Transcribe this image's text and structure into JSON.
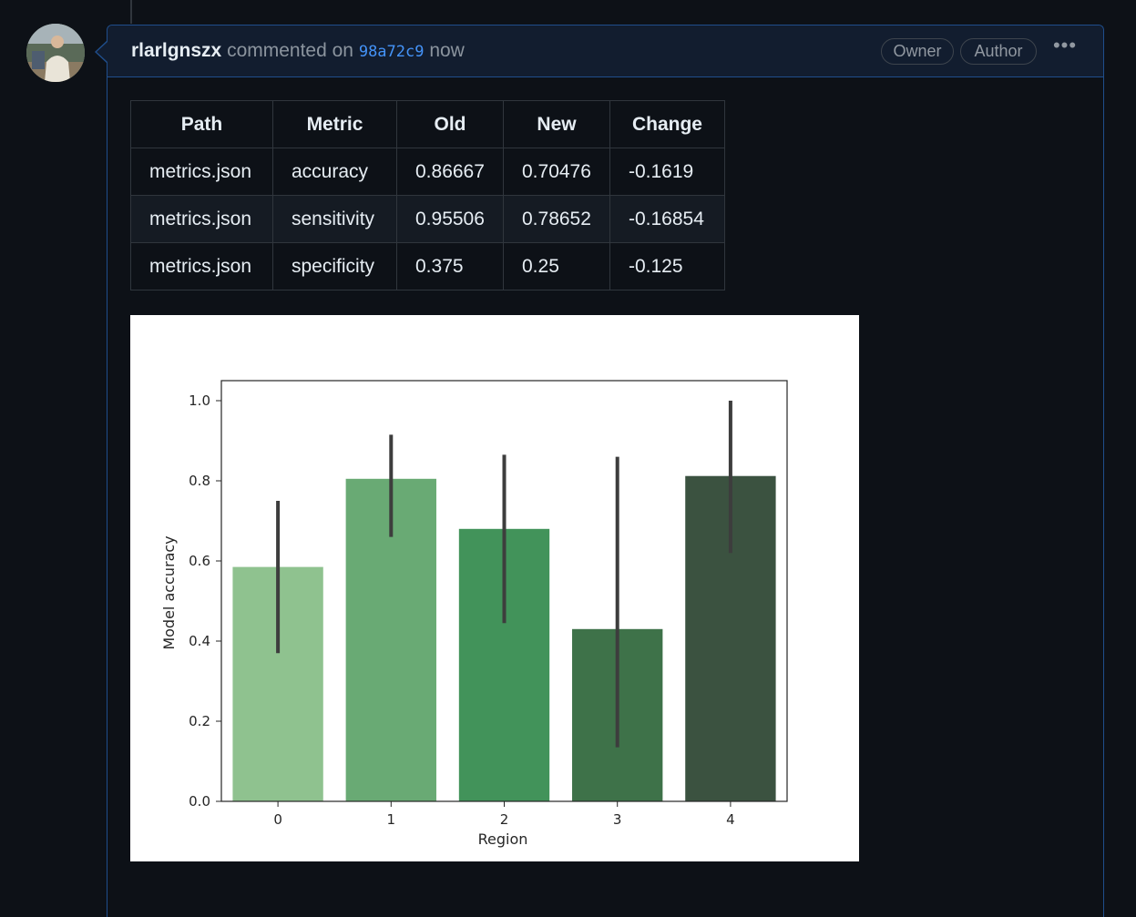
{
  "comment": {
    "author": "rlarlgnszx",
    "action": "commented on",
    "commit": "98a72c9",
    "time": "now",
    "badges": {
      "owner": "Owner",
      "author": "Author"
    }
  },
  "table": {
    "headers": [
      "Path",
      "Metric",
      "Old",
      "New",
      "Change"
    ],
    "rows": [
      [
        "metrics.json",
        "accuracy",
        "0.86667",
        "0.70476",
        "-0.1619"
      ],
      [
        "metrics.json",
        "sensitivity",
        "0.95506",
        "0.78652",
        "-0.16854"
      ],
      [
        "metrics.json",
        "specificity",
        "0.375",
        "0.25",
        "-0.125"
      ]
    ]
  },
  "chart_data": {
    "type": "bar",
    "xlabel": "Region",
    "ylabel": "Model accuracy",
    "categories": [
      "0",
      "1",
      "2",
      "3",
      "4"
    ],
    "values": [
      0.585,
      0.805,
      0.68,
      0.43,
      0.812
    ],
    "error_low": [
      0.37,
      0.66,
      0.445,
      0.135,
      0.62
    ],
    "error_high": [
      0.75,
      0.915,
      0.865,
      0.86,
      1.0
    ],
    "ylim": [
      0,
      1.05
    ],
    "yticks": [
      "0.0",
      "0.2",
      "0.4",
      "0.6",
      "0.8",
      "1.0"
    ],
    "colors": [
      "#8fc28f",
      "#69aa74",
      "#42935a",
      "#3e7249",
      "#3b5240"
    ],
    "grid": false
  }
}
